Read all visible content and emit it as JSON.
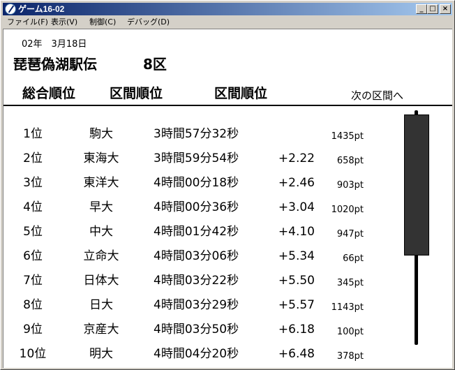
{
  "window": {
    "title": "ゲーム16-02",
    "buttons": {
      "minimize": "_",
      "maximize": "□",
      "close": "×"
    }
  },
  "menu": [
    "ファイル(F)",
    "表示(V)",
    "制御(C)",
    "デバッグ(D)"
  ],
  "header": {
    "date": "02年　3月18日",
    "race": "琵琶偽湖駅伝",
    "section": "8区"
  },
  "tabs": [
    "総合順位",
    "区間順位",
    "区間順位"
  ],
  "next_button": "次の区間へ",
  "standings": [
    {
      "rank": "1位",
      "team": "駒大",
      "time": "3時間57分32秒",
      "gap": "",
      "points": "1435pt"
    },
    {
      "rank": "2位",
      "team": "東海大",
      "time": "3時間59分54秒",
      "gap": "+2.22",
      "points": "658pt"
    },
    {
      "rank": "3位",
      "team": "東洋大",
      "time": "4時間00分18秒",
      "gap": "+2.46",
      "points": "903pt"
    },
    {
      "rank": "4位",
      "team": "早大",
      "time": "4時間00分36秒",
      "gap": "+3.04",
      "points": "1020pt"
    },
    {
      "rank": "5位",
      "team": "中大",
      "time": "4時間01分42秒",
      "gap": "+4.10",
      "points": "947pt"
    },
    {
      "rank": "6位",
      "team": "立命大",
      "time": "4時間03分06秒",
      "gap": "+5.34",
      "points": "66pt"
    },
    {
      "rank": "7位",
      "team": "日体大",
      "time": "4時間03分22秒",
      "gap": "+5.50",
      "points": "345pt"
    },
    {
      "rank": "8位",
      "team": "日大",
      "time": "4時間03分29秒",
      "gap": "+5.57",
      "points": "1143pt"
    },
    {
      "rank": "9位",
      "team": "京産大",
      "time": "4時間03分50秒",
      "gap": "+6.18",
      "points": "100pt"
    },
    {
      "rank": "10位",
      "team": "明大",
      "time": "4時間04分20秒",
      "gap": "+6.48",
      "points": "378pt"
    }
  ],
  "scrollbar": {
    "thumb_start_fraction": 0.0,
    "thumb_size_fraction": 0.6
  },
  "colors": {
    "title_start": "#0a246a",
    "title_end": "#a6caf0",
    "gauge": "#333333"
  }
}
